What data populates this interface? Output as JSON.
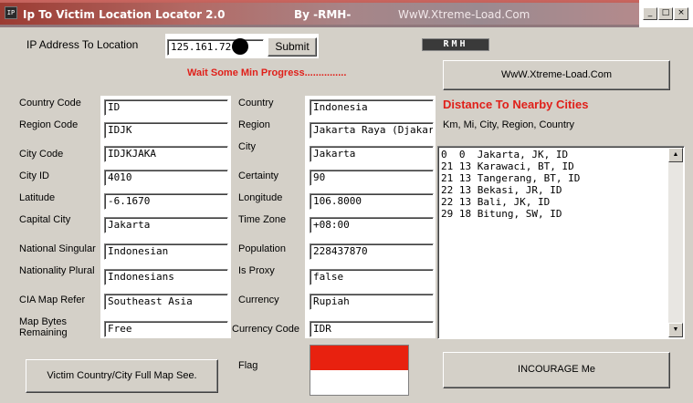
{
  "window": {
    "app_icon": "IP",
    "title": "Ip To Victim Location Locator 2.0",
    "author": "By -RMH-",
    "site": "WwW.Xtreme-Load.Com",
    "minimize": "_",
    "maximize": "□",
    "close": "×"
  },
  "top": {
    "ip_label": "IP Address To Location",
    "ip_value": "125.161.72.",
    "submit": "Submit",
    "logo": "RMH",
    "progress": "Wait Some Min Progress...............",
    "site_button": "WwW.Xtreme-Load.Com"
  },
  "left_fields": [
    {
      "label": "Country Code",
      "value": "ID"
    },
    {
      "label": "Region Code",
      "value": "IDJK"
    },
    {
      "label": "City Code",
      "value": "IDJKJAKA"
    },
    {
      "label": "City ID",
      "value": "4010"
    },
    {
      "label": "Latitude",
      "value": "-6.1670"
    },
    {
      "label": "Capital City",
      "value": "Jakarta"
    },
    {
      "label": "National Singular",
      "value": "Indonesian"
    },
    {
      "label": "Nationality Plural",
      "value": "Indonesians"
    },
    {
      "label": "CIA Map Refer",
      "value": "Southeast Asia"
    },
    {
      "label": "Map Bytes Remaining",
      "value": "Free"
    }
  ],
  "right_fields": [
    {
      "label": "Country",
      "value": "Indonesia"
    },
    {
      "label": "Region",
      "value": "Jakarta Raya (Djakarta"
    },
    {
      "label": "City",
      "value": "Jakarta"
    },
    {
      "label": "Certainty",
      "value": "90"
    },
    {
      "label": "Longitude",
      "value": "106.8000"
    },
    {
      "label": "Time Zone",
      "value": "+08:00"
    },
    {
      "label": "Population",
      "value": "228437870"
    },
    {
      "label": "Is Proxy",
      "value": "false"
    },
    {
      "label": "Currency",
      "value": "Rupiah"
    },
    {
      "label": "Currency Code",
      "value": "IDR"
    }
  ],
  "flag": {
    "label": "Flag",
    "top_color": "#e8210f",
    "bottom_color": "#ffffff"
  },
  "cities": {
    "title": "Distance To Nearby Cities",
    "header": "Km,  Mi, City, Region, Country",
    "items": [
      "0  0  Jakarta, JK, ID",
      "21 13 Karawaci, BT, ID",
      "21 13 Tangerang, BT, ID",
      "22 13 Bekasi, JR, ID",
      "22 13 Bali, JK, ID",
      "29 18 Bitung, SW, ID"
    ]
  },
  "buttons": {
    "map": "Victim Country/City Full Map See.",
    "encourage": "INCOURAGE Me"
  },
  "icons": {
    "scroll_up": "▲",
    "scroll_down": "▼"
  }
}
